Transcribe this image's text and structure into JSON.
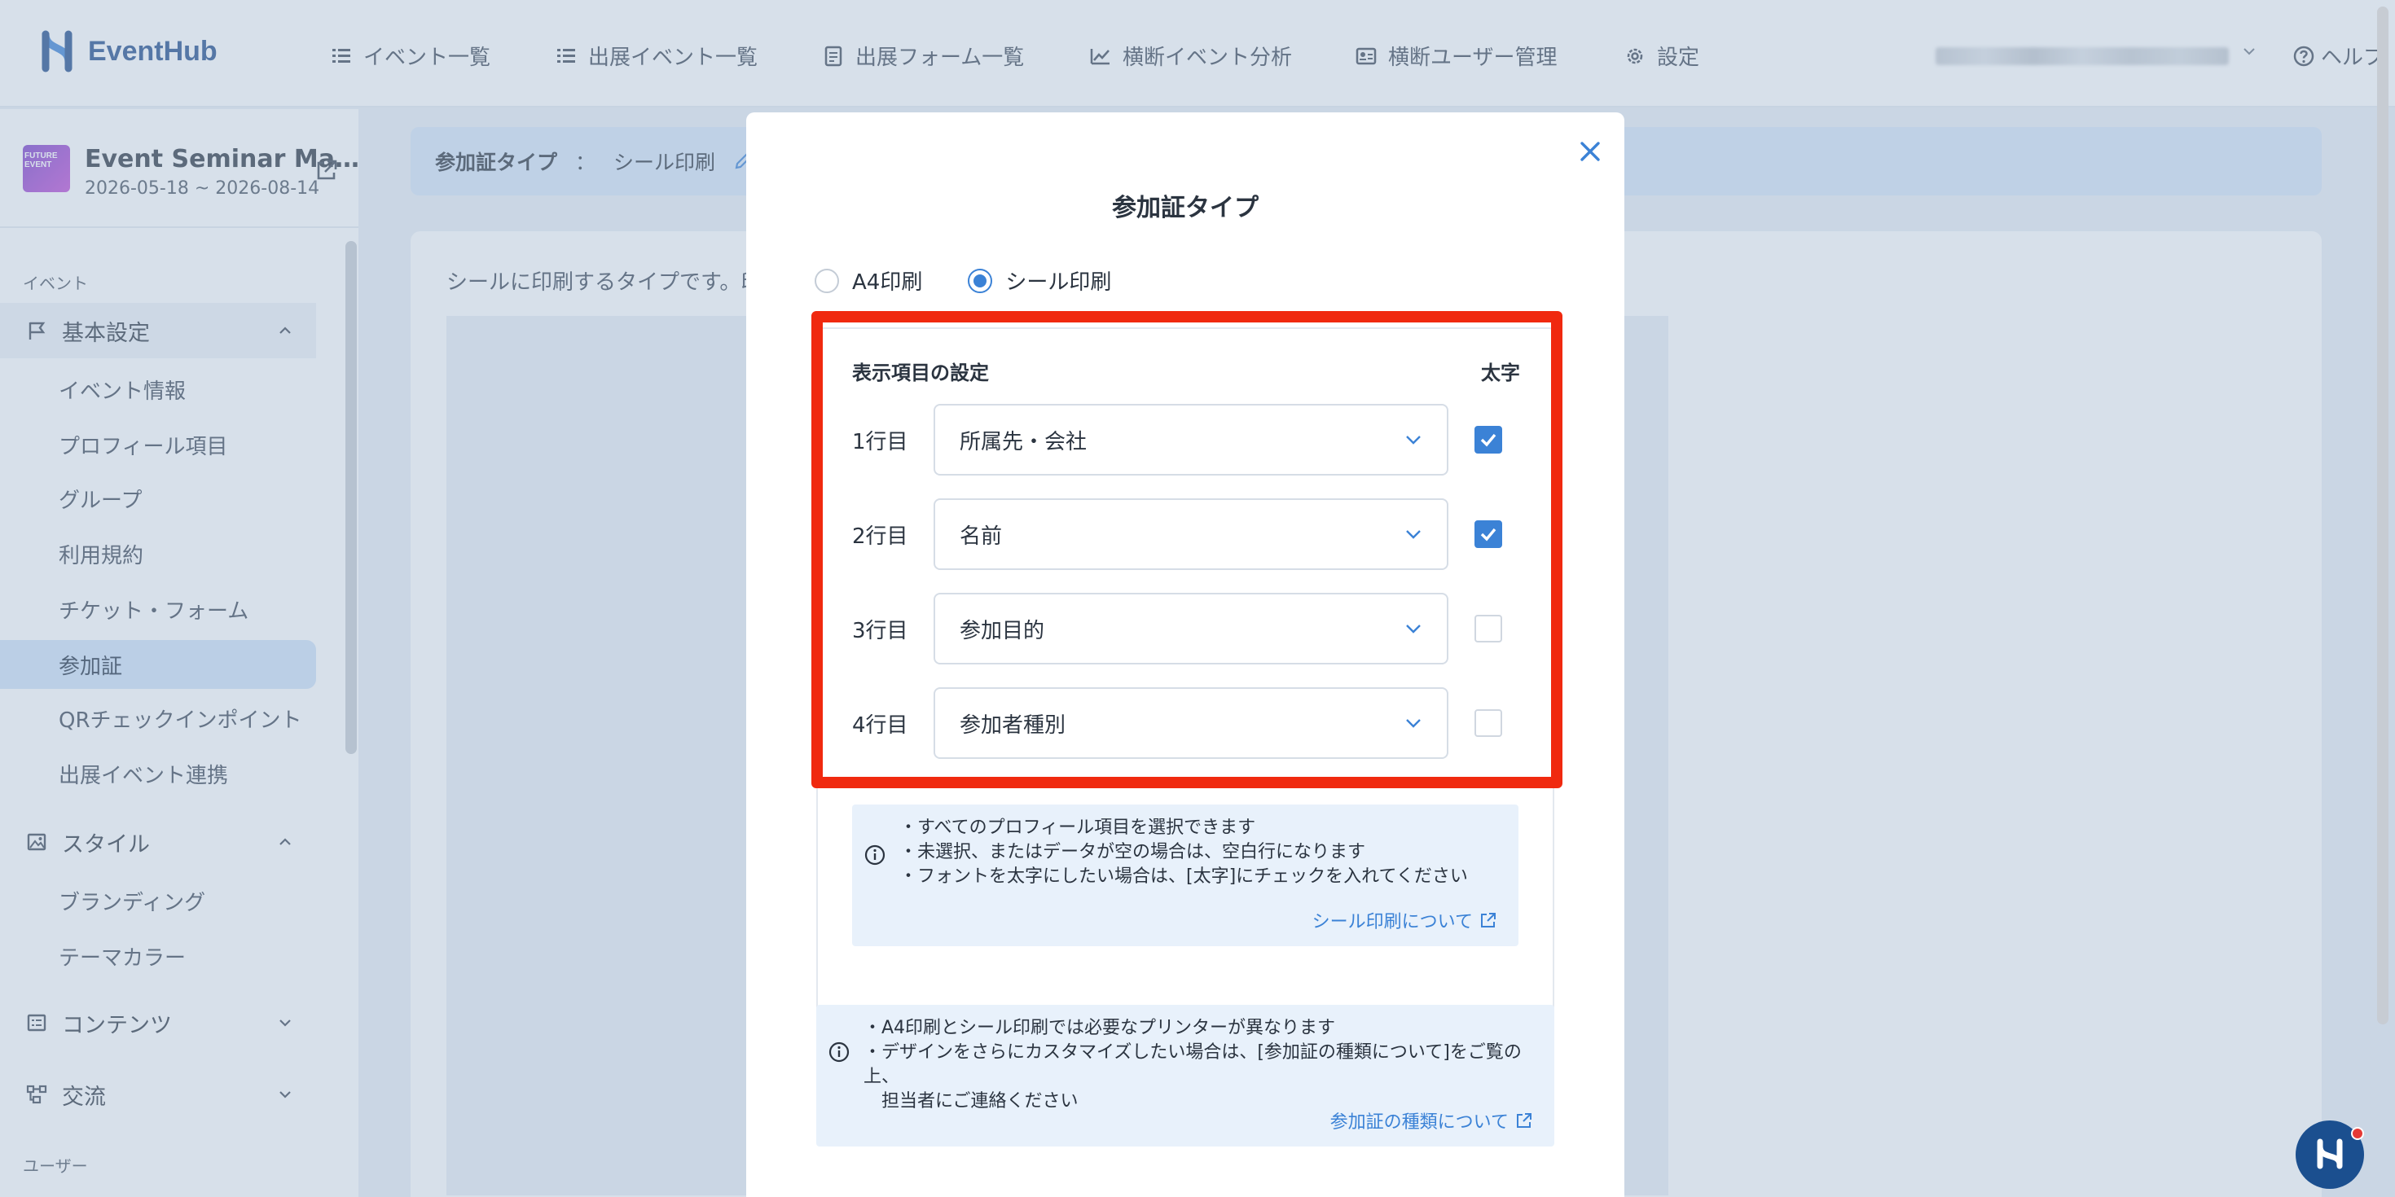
{
  "app": {
    "logo_text": "EventHub"
  },
  "nav": {
    "items": [
      {
        "label": "イベント一覧",
        "icon": "list-icon"
      },
      {
        "label": "出展イベント一覧",
        "icon": "list-icon"
      },
      {
        "label": "出展フォーム一覧",
        "icon": "form-icon"
      },
      {
        "label": "横断イベント分析",
        "icon": "chart-icon"
      },
      {
        "label": "横断ユーザー管理",
        "icon": "id-card-icon"
      },
      {
        "label": "設定",
        "icon": "gear-icon"
      }
    ],
    "help_label": "ヘルプ"
  },
  "event": {
    "thumb_text": "FUTURE EVENT",
    "name": "Event Seminar Ma…",
    "dates": "2026-05-18 ~ 2026-08-14"
  },
  "sidebar": {
    "section_event": "イベント",
    "group_basic": "基本設定",
    "basic_items": [
      "イベント情報",
      "プロフィール項目",
      "グループ",
      "利用規約",
      "チケット・フォーム",
      "参加証",
      "QRチェックインポイント",
      "出展イベント連携"
    ],
    "group_style": "スタイル",
    "style_items": [
      "ブランディング",
      "テーマカラー"
    ],
    "group_contents": "コンテンツ",
    "group_exchange": "交流",
    "section_user": "ユーザー"
  },
  "main": {
    "breadcrumb_label": "参加証タイプ",
    "breadcrumb_sep": "：",
    "breadcrumb_value": "シール印刷",
    "desc": "シールに印刷するタイプです。印"
  },
  "modal": {
    "title": "参加証タイプ",
    "radio_a4": "A4印刷",
    "radio_seal": "シール印刷",
    "selected": "シール印刷",
    "settings_head": "表示項目の設定",
    "bold_head": "太字",
    "rows": [
      {
        "label": "1行目",
        "value": "所属先・会社",
        "bold": true
      },
      {
        "label": "2行目",
        "value": "名前",
        "bold": true
      },
      {
        "label": "3行目",
        "value": "参加目的",
        "bold": false
      },
      {
        "label": "4行目",
        "value": "参加者種別",
        "bold": false
      }
    ],
    "info_lines": [
      "・すべてのプロフィール項目を選択できます",
      "・未選択、またはデータが空の場合は、空白行になります",
      "・フォントを太字にしたい場合は、[太字]にチェックを入れてください"
    ],
    "info_link": "シール印刷について",
    "note_lines": [
      "・A4印刷とシール印刷では必要なプリンターが異なります",
      "・デザインをさらにカスタマイズしたい場合は、[参加証の種類について]をご覧の上、",
      "　担当者にご連絡ください"
    ],
    "note_link": "参加証の種類について"
  },
  "colors": {
    "accent": "#3b82d6",
    "highlight": "#f0290f",
    "brand": "#1f4a8a"
  }
}
